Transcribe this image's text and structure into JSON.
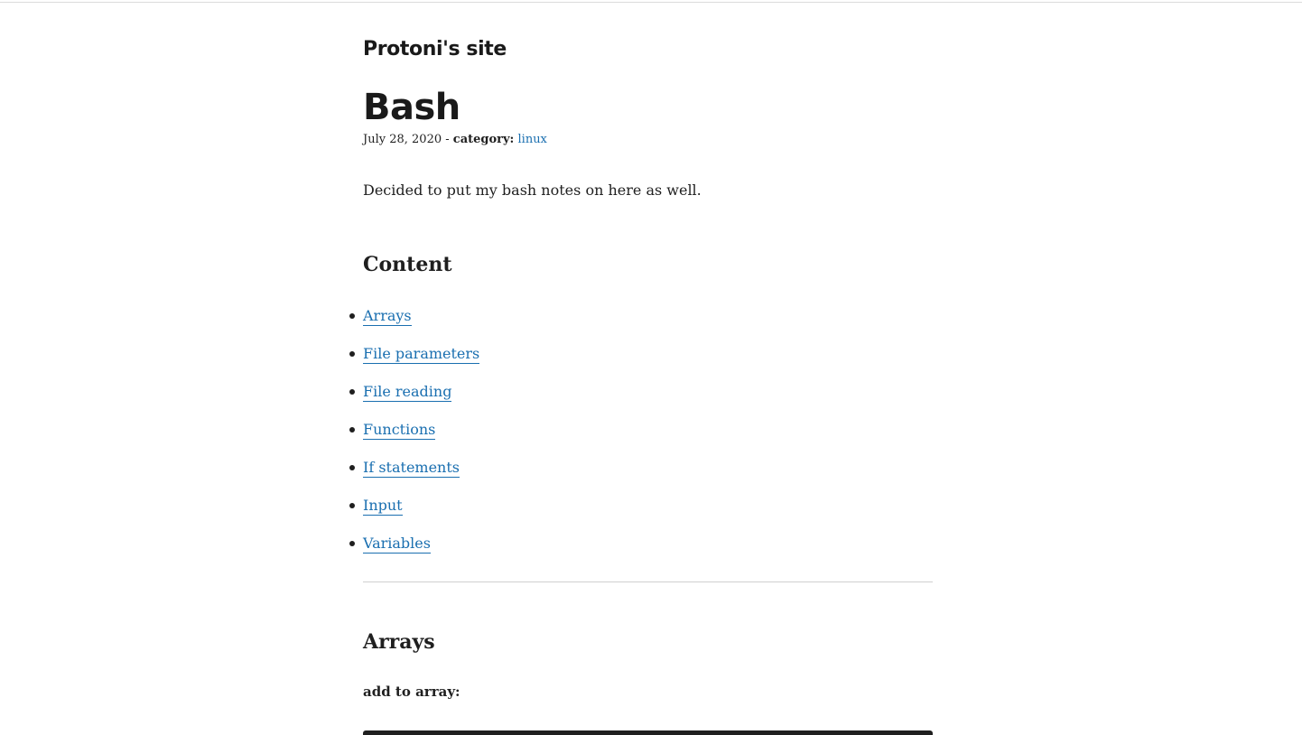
{
  "site": {
    "title": "Protoni's site"
  },
  "post": {
    "title": "Bash",
    "date": "July 28, 2020",
    "separator": " - ",
    "category_label": "category:",
    "category": "linux",
    "intro": "Decided to put my bash notes on here as well."
  },
  "toc": {
    "heading": "Content",
    "items": [
      {
        "label": "Arrays"
      },
      {
        "label": "File parameters"
      },
      {
        "label": "File reading"
      },
      {
        "label": "Functions"
      },
      {
        "label": "If statements"
      },
      {
        "label": "Input"
      },
      {
        "label": "Variables"
      }
    ]
  },
  "sections": {
    "arrays": {
      "heading": "Arrays",
      "sub_label": "add to array:"
    }
  },
  "colors": {
    "link": "#1a6fb0",
    "text": "#1f1f1f",
    "code_bg": "#1f1f1f"
  }
}
